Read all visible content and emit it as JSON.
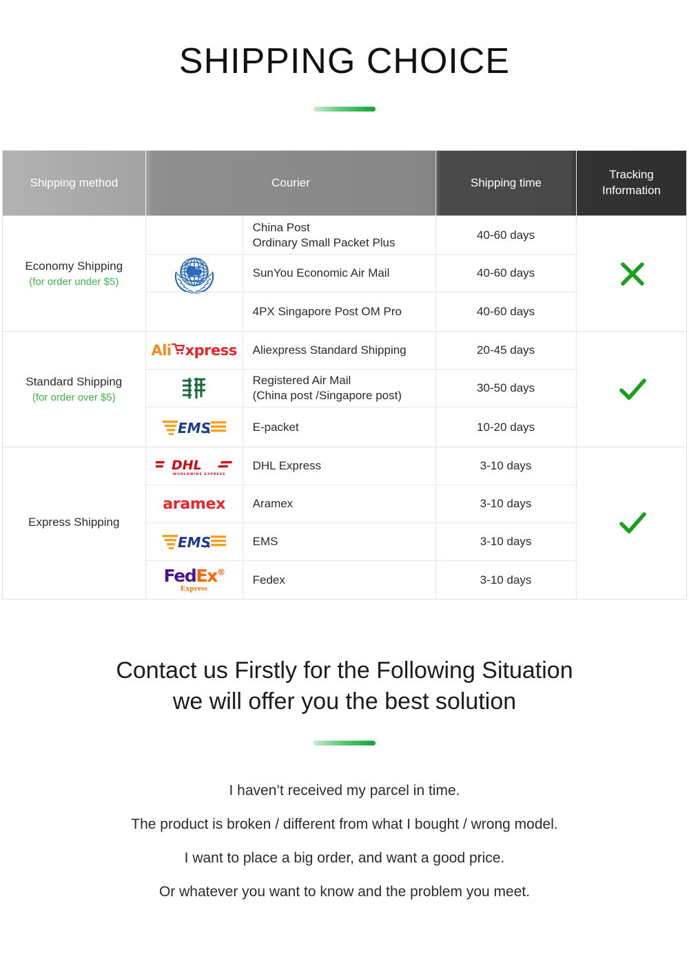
{
  "title": "SHIPPING CHOICE",
  "accent_color": "#2bb24c",
  "divider_gradient": [
    "#c8ecd0",
    "#19a33e"
  ],
  "table": {
    "headers": {
      "method": "Shipping method",
      "courier": "Courier",
      "time": "Shipping time",
      "tracking": "Tracking\nInformation",
      "tracking_line1": "Tracking",
      "tracking_line2": "Information"
    },
    "groups": [
      {
        "method": "Economy Shipping",
        "method_note": "(for order under $5)",
        "tracking": "no",
        "tracking_icon": "cross-icon",
        "rows": [
          {
            "logo": "un-logo",
            "logo_span": 3,
            "courier_line1": "China Post",
            "courier_line2": "Ordinary Small Packet Plus",
            "time": "40-60 days"
          },
          {
            "logo": null,
            "courier_line1": "SunYou Economic Air Mail",
            "courier_line2": "",
            "time": "40-60 days"
          },
          {
            "logo": null,
            "courier_line1": "4PX Singapore Post OM Pro",
            "courier_line2": "",
            "time": "40-60 days"
          }
        ]
      },
      {
        "method": "Standard Shipping",
        "method_note": "(for order over $5)",
        "tracking": "yes",
        "tracking_icon": "check-icon",
        "rows": [
          {
            "logo": "aliexpress-logo",
            "courier_line1": "Aliexpress Standard Shipping",
            "courier_line2": "",
            "time": "20-45 days"
          },
          {
            "logo": "china-post-logo",
            "courier_line1": "Registered Air Mail",
            "courier_line2": "(China post /Singapore post)",
            "time": "30-50 days"
          },
          {
            "logo": "ems-logo",
            "courier_line1": "E-packet",
            "courier_line2": "",
            "time": "10-20 days"
          }
        ]
      },
      {
        "method": "Express Shipping",
        "method_note": "",
        "tracking": "yes",
        "tracking_icon": "check-icon",
        "rows": [
          {
            "logo": "dhl-logo",
            "courier_line1": "DHL Express",
            "courier_line2": "",
            "time": "3-10 days"
          },
          {
            "logo": "aramex-logo",
            "courier_line1": "Aramex",
            "courier_line2": "",
            "time": "3-10 days"
          },
          {
            "logo": "ems-logo",
            "courier_line1": "EMS",
            "courier_line2": "",
            "time": "3-10 days"
          },
          {
            "logo": "fedex-logo",
            "courier_line1": "Fedex",
            "courier_line2": "",
            "time": "3-10 days"
          }
        ]
      }
    ]
  },
  "contact": {
    "heading_line1": "Contact us Firstly for the Following Situation",
    "heading_line2": "we will offer you the best solution",
    "situations": [
      "I haven’t received my parcel in time.",
      "The product is broken / different from what I bought / wrong model.",
      "I want to place a big order, and want a good price.",
      "Or whatever you want to know and the problem you meet."
    ]
  },
  "logo_labels": {
    "aliexpress_ali": "Ali",
    "aliexpress_xpress": "xpress",
    "aramex": "aramex",
    "fedex_fed": "Fed",
    "fedex_ex": "Ex",
    "fedex_sub": "Express"
  }
}
